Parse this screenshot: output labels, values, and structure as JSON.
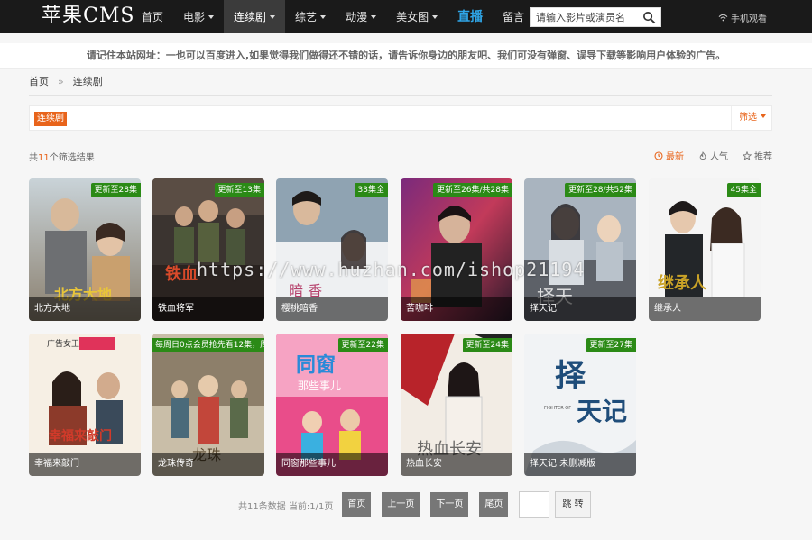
{
  "site": {
    "logo": "苹果CMS"
  },
  "nav": [
    {
      "label": "首页",
      "dropdown": false,
      "active": false
    },
    {
      "label": "电影",
      "dropdown": true,
      "active": false
    },
    {
      "label": "连续剧",
      "dropdown": true,
      "active": true
    },
    {
      "label": "综艺",
      "dropdown": true,
      "active": false
    },
    {
      "label": "动漫",
      "dropdown": true,
      "active": false
    },
    {
      "label": "美女图",
      "dropdown": true,
      "active": false
    },
    {
      "label": "直播",
      "dropdown": false,
      "active": false,
      "highlight": true
    },
    {
      "label": "留言",
      "dropdown": false,
      "active": false
    }
  ],
  "search": {
    "placeholder": "请输入影片或演员名",
    "icon": "search-icon"
  },
  "mobile": {
    "label": "手机观看",
    "icon": "wifi-icon"
  },
  "notice": "请记住本站网址：一也可以百度进入,如果觉得我们做得还不错的话，请告诉你身边的朋友吧、我们可没有弹窗、误导下载等影响用户体验的广告。",
  "breadcrumb": {
    "home": "首页",
    "separator": "»",
    "current": "连续剧"
  },
  "filter": {
    "tag": "连续剧",
    "button": "筛选"
  },
  "results": {
    "prefix": "共",
    "count": "11",
    "suffix": "个筛选结果"
  },
  "sorts": [
    {
      "label": "最新",
      "icon": "clock-icon",
      "active": true
    },
    {
      "label": "人气",
      "icon": "fire-icon",
      "active": false
    },
    {
      "label": "推荐",
      "icon": "star-icon",
      "active": false
    }
  ],
  "items": [
    {
      "title": "北方大地",
      "badge": "更新至28集"
    },
    {
      "title": "铁血将军",
      "badge": "更新至13集"
    },
    {
      "title": "樱桃暗香",
      "badge": "33集全"
    },
    {
      "title": "苦咖啡",
      "badge": "更新至26集/共28集"
    },
    {
      "title": "择天记",
      "badge": "更新至28/共52集"
    },
    {
      "title": "继承人",
      "badge": "45集全"
    },
    {
      "title": "幸福来敲门",
      "badge": ""
    },
    {
      "title": "龙珠传奇",
      "badge": "每周日0点会员抢先看12集，周"
    },
    {
      "title": "同窗那些事儿",
      "badge": "更新至22集"
    },
    {
      "title": "热血长安",
      "badge": "更新至24集"
    },
    {
      "title": "择天记 未删减版",
      "badge": "更新至27集"
    }
  ],
  "watermark": "https://www.huzhan.com/ishop21194",
  "pagination": {
    "info": "共11条数据 当前:1/1页",
    "first": "首页",
    "prev": "上一页",
    "next": "下一页",
    "last": "尾页",
    "go": "跳 转"
  },
  "colors": {
    "accent": "#e8641b",
    "badge": "#2b8a16",
    "nav_bg": "#1a1a1a",
    "live": "#2fa6e8"
  }
}
